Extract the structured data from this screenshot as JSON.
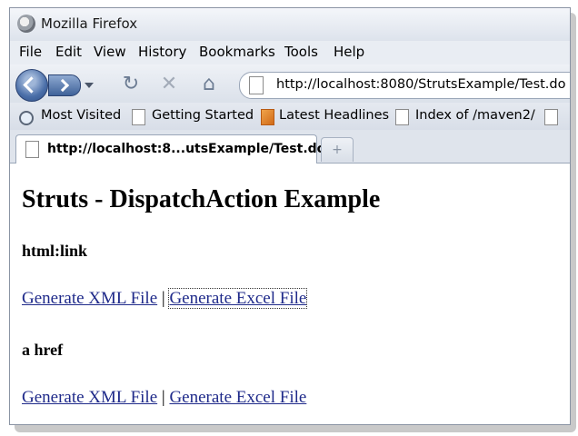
{
  "window": {
    "title": "Mozilla Firefox"
  },
  "menu": {
    "file": "File",
    "edit": "Edit",
    "view": "View",
    "history": "History",
    "bookmarks": "Bookmarks",
    "tools": "Tools",
    "help": "Help"
  },
  "nav": {
    "url": "http://localhost:8080/StrutsExample/Test.do"
  },
  "bookmarks_bar": {
    "most_visited": "Most Visited",
    "getting_started": "Getting Started",
    "latest_headlines": "Latest Headlines",
    "index_maven": "Index of /maven2/"
  },
  "tabs": {
    "active_label": "http://localhost:8...utsExample/Test.do",
    "new_tab": "+"
  },
  "page": {
    "heading": "Struts - DispatchAction Example",
    "section1_title": "html:link",
    "section1_link1": "Generate XML File",
    "separator": "|",
    "section1_link2": "Generate Excel File",
    "section2_title": "a href",
    "section2_link1": "Generate XML File",
    "section2_link2": "Generate Excel File"
  },
  "icons": {
    "back": "back-arrow-icon",
    "forward": "forward-arrow-icon",
    "reload": "reload-icon",
    "stop": "stop-icon",
    "home": "home-icon",
    "page": "page-icon",
    "rss": "rss-icon"
  },
  "colors": {
    "link": "#1f2a8a",
    "chrome": "#dde3ec"
  }
}
